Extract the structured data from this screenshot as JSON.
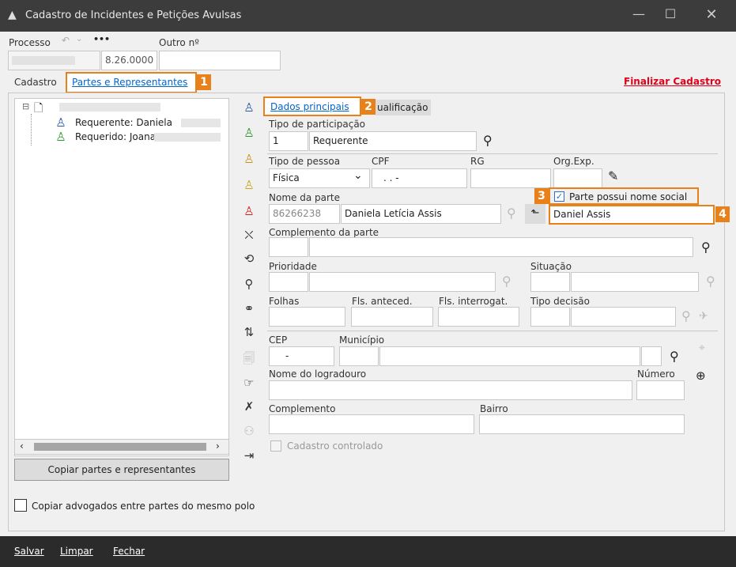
{
  "window": {
    "title": "Cadastro de Incidentes e Petições Avulsas"
  },
  "processo": {
    "label": "Processo",
    "value": "8.26.0000",
    "dots": "•••",
    "outro_label": "Outro nº"
  },
  "tabs": {
    "cadastro": "Cadastro",
    "partes": "Partes e Representantes"
  },
  "finalizar": "Finalizar Cadastro",
  "callouts": [
    "1",
    "2",
    "3",
    "4"
  ],
  "tree": {
    "requerente": "Requerente: Daniela",
    "requerido": "Requerido: Joana"
  },
  "left_buttons": {
    "copiar": "Copiar partes e representantes"
  },
  "copiar_adv": "Copiar advogados entre partes do mesmo polo",
  "subtabs": {
    "dados": "Dados principais",
    "qualificacao": "ualificação"
  },
  "form": {
    "tipo_participacao": {
      "label": "Tipo de participação",
      "code": "1",
      "value": "Requerente"
    },
    "tipo_pessoa": {
      "label": "Tipo de pessoa",
      "value": "Física"
    },
    "cpf": {
      "label": "CPF",
      "value": ".   .   -"
    },
    "rg": {
      "label": "RG"
    },
    "org_exp": {
      "label": "Org.Exp."
    },
    "nome_parte": {
      "label": "Nome da parte",
      "code": "86266238",
      "value": "Daniela Letícia Assis"
    },
    "nome_social": {
      "checkbox_label": "Parte possui nome social",
      "value": "Daniel Assis"
    },
    "complemento_parte": {
      "label": "Complemento da parte"
    },
    "prioridade": {
      "label": "Prioridade"
    },
    "situacao": {
      "label": "Situação"
    },
    "folhas": {
      "label": "Folhas"
    },
    "fls_anteced": {
      "label": "Fls. anteced."
    },
    "fls_interrogat": {
      "label": "Fls. interrogat."
    },
    "tipo_decisao": {
      "label": "Tipo decisão"
    },
    "cep": {
      "label": "CEP",
      "value": "-"
    },
    "municipio": {
      "label": "Município"
    },
    "logradouro": {
      "label": "Nome do logradouro"
    },
    "numero": {
      "label": "Número"
    },
    "complemento": {
      "label": "Complemento"
    },
    "bairro": {
      "label": "Bairro"
    },
    "cadastro_controlado": {
      "label": "Cadastro controlado"
    }
  },
  "bottom": {
    "salvar": "Salvar",
    "limpar": "Limpar",
    "fechar": "Fechar"
  },
  "colors": {
    "accent": "#e8811a",
    "link": "#0066cc",
    "finalizar": "#e0001a"
  }
}
